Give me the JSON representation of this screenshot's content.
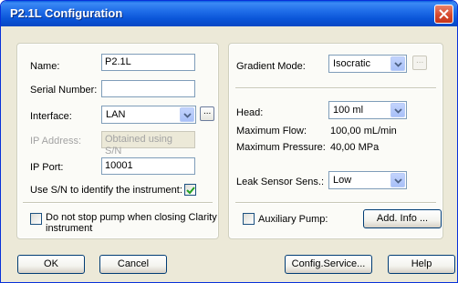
{
  "window": {
    "title": "P2.1L Configuration"
  },
  "left": {
    "name": {
      "label": "Name:",
      "value": "P2.1L"
    },
    "serial": {
      "label": "Serial Number:",
      "value": ""
    },
    "interface": {
      "label": "Interface:",
      "value": "LAN",
      "more": "..."
    },
    "ip_address": {
      "label": "IP Address:",
      "value": "Obtained using S/N"
    },
    "ip_port": {
      "label": "IP Port:",
      "value": "10001"
    },
    "use_sn": {
      "label": "Use S/N to identify the instrument:",
      "checked": true
    },
    "no_stop": {
      "label_line1": "Do not stop pump when closing Clarity",
      "label_line2": "instrument",
      "checked": false
    }
  },
  "right": {
    "gradient_mode": {
      "label": "Gradient Mode:",
      "value": "Isocratic",
      "more": "..."
    },
    "head": {
      "label": "Head:",
      "value": "100 ml"
    },
    "max_flow": {
      "label": "Maximum Flow:",
      "value": "100,00 mL/min"
    },
    "max_pressure": {
      "label": "Maximum Pressure:",
      "value": "40,00 MPa"
    },
    "leak_sensor": {
      "label": "Leak Sensor Sens.:",
      "value": "Low"
    },
    "aux_pump": {
      "label": "Auxiliary Pump:",
      "checked": false
    },
    "add_info": "Add. Info ..."
  },
  "buttons": {
    "ok": "OK",
    "cancel": "Cancel",
    "config_service": "Config.Service...",
    "help": "Help"
  },
  "colors": {
    "titlebar": "#0a55d8",
    "dialog_bg": "#ece9d8",
    "close": "#d5462a"
  }
}
